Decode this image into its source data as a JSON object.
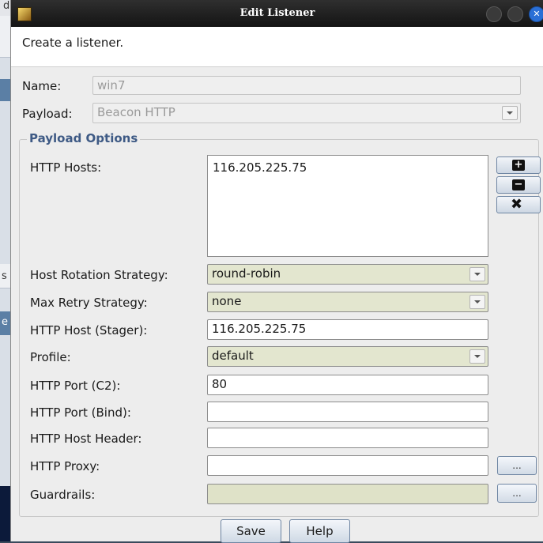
{
  "background": {
    "menu_fragment": "d",
    "side_fragments": [
      "s",
      "e"
    ]
  },
  "dialog": {
    "title": "Edit Listener",
    "description": "Create a listener.",
    "name": {
      "label": "Name:",
      "value": "win7"
    },
    "payload": {
      "label": "Payload:",
      "value": "Beacon HTTP"
    },
    "group_title": "Payload Options",
    "http_hosts": {
      "label": "HTTP Hosts:",
      "items": [
        "116.205.225.75"
      ]
    },
    "host_buttons": {
      "add": "add-icon",
      "remove": "remove-icon",
      "clear": "clear-icon"
    },
    "host_rotation": {
      "label": "Host Rotation Strategy:",
      "value": "round-robin"
    },
    "max_retry": {
      "label": "Max Retry Strategy:",
      "value": "none"
    },
    "stager_host": {
      "label": "HTTP Host (Stager):",
      "value": "116.205.225.75"
    },
    "profile": {
      "label": "Profile:",
      "value": "default"
    },
    "port_c2": {
      "label": "HTTP Port (C2):",
      "value": "80"
    },
    "port_bind": {
      "label": "HTTP Port (Bind):",
      "value": ""
    },
    "host_header": {
      "label": "HTTP Host Header:",
      "value": ""
    },
    "proxy": {
      "label": "HTTP Proxy:",
      "value": "",
      "button": "..."
    },
    "guardrails": {
      "label": "Guardrails:",
      "value": "",
      "button": "..."
    },
    "save_label": "Save",
    "help_label": "Help"
  },
  "colors": {
    "title_bar": "#1c1c1c",
    "group_title": "#3e5a85",
    "combo_fill": "#e3e6cf",
    "close_button": "#2a6fd6"
  }
}
